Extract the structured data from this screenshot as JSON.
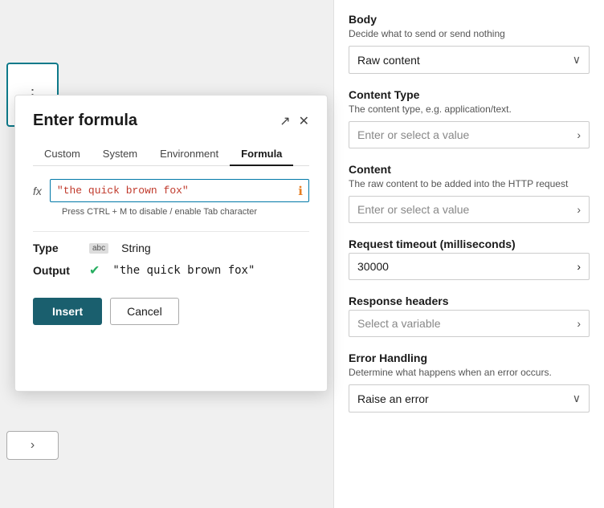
{
  "modal": {
    "title": "Enter formula",
    "expand_icon": "↗",
    "close_icon": "✕",
    "tabs": [
      {
        "id": "custom",
        "label": "Custom"
      },
      {
        "id": "system",
        "label": "System"
      },
      {
        "id": "environment",
        "label": "Environment"
      },
      {
        "id": "formula",
        "label": "Formula",
        "active": true
      }
    ],
    "fx_label": "fx",
    "formula_value": "\"the quick brown fox\"",
    "info_icon": "ℹ",
    "hint": "Press CTRL + M to disable / enable Tab character",
    "type_label": "Type",
    "type_icon": "abc",
    "type_value": "String",
    "output_label": "Output",
    "output_value": "\"the quick brown fox\"",
    "insert_button": "Insert",
    "cancel_button": "Cancel"
  },
  "right_panel": {
    "body_section": {
      "title": "Body",
      "subtitle": "Decide what to send or send nothing",
      "dropdown_value": "Raw content",
      "chevron": "∨"
    },
    "content_type_section": {
      "title": "Content Type",
      "subtitle": "The content type, e.g. application/text.",
      "placeholder": "Enter or select a value",
      "arrow": "›"
    },
    "content_section": {
      "title": "Content",
      "subtitle": "The raw content to be added into the HTTP request",
      "placeholder": "Enter or select a value",
      "arrow": "›"
    },
    "timeout_section": {
      "title": "Request timeout (milliseconds)",
      "value": "30000",
      "arrow": "›"
    },
    "response_headers_section": {
      "title": "Response headers",
      "placeholder": "Select a variable",
      "arrow": "›"
    },
    "error_handling_section": {
      "title": "Error Handling",
      "subtitle": "Determine what happens when an error occurs.",
      "dropdown_value": "Raise an error",
      "chevron": "∨"
    }
  }
}
